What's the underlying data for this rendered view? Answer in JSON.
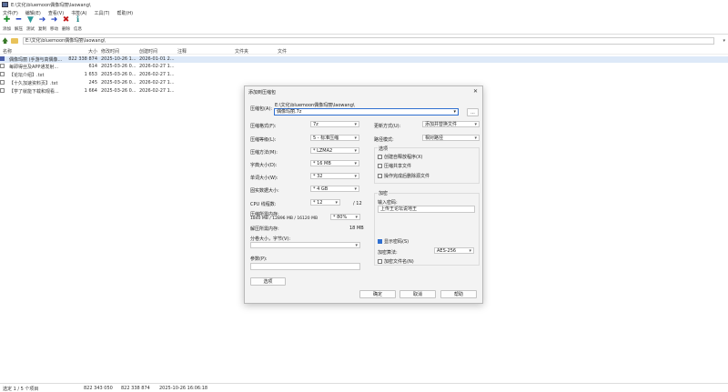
{
  "window": {
    "title": "E:\\文化\\bluemoon偶像玛丽\\laowang\\"
  },
  "menu": [
    "文件(F)",
    "编辑(E)",
    "查看(V)",
    "书签(A)",
    "工具(T)",
    "帮助(H)"
  ],
  "toolbar": [
    {
      "label": "添加",
      "icon": "add-icon",
      "color": "#1a8c2a"
    },
    {
      "label": "解压",
      "icon": "extract-icon",
      "color": "#1e3fbf"
    },
    {
      "label": "测试",
      "icon": "test-icon",
      "color": "#2a9a9a"
    },
    {
      "label": "复制",
      "icon": "copy-icon",
      "color": "#1e3fbf"
    },
    {
      "label": "移动",
      "icon": "move-icon",
      "color": "#1e3fbf"
    },
    {
      "label": "删除",
      "icon": "delete-icon",
      "color": "#c21a1a"
    },
    {
      "label": "信息",
      "icon": "info-icon",
      "color": "#2a8a8a"
    }
  ],
  "address": {
    "path": "E:\\文化\\bluemoon偶像玛丽\\laowang\\"
  },
  "columns": {
    "name": "名称",
    "size": "大小",
    "modified": "修改时间",
    "created": "创建时间",
    "comment": "注释",
    "folders": "文件夹",
    "files": "文件"
  },
  "files": [
    {
      "name": "偶像玛丽 (手游与高偶像...",
      "size": "822 338 874",
      "modified": "2025-10-26 1...",
      "created": "2026-01-01 2..."
    },
    {
      "name": "每即得丝及APP通发射...",
      "size": "614",
      "modified": "2025-03-26 0...",
      "created": "2026-02-27 1..."
    },
    {
      "name": "【论坛介绍】.txt",
      "size": "1 653",
      "modified": "2025-03-26 0...",
      "created": "2026-02-27 1..."
    },
    {
      "name": "【十久加速资料页】.txt",
      "size": "245",
      "modified": "2025-03-26 0...",
      "created": "2026-02-27 1..."
    },
    {
      "name": "【学了就能下载和观看...",
      "size": "1 664",
      "modified": "2025-03-26 0...",
      "created": "2026-02-27 1..."
    }
  ],
  "status": {
    "selection": "选定 1 / 5 个项目",
    "total": "822 343 050",
    "selected_size": "822 338 874",
    "date": "2025-10-26 16:06:18"
  },
  "dialog": {
    "title": "添加到压缩包",
    "close": "✕",
    "archive_label": "压缩包(A):",
    "archive_path": "E:\\文化\\bluemoon偶像玛丽\\laowang\\",
    "archive_name": "偶像玛丽.7z",
    "browse": "...",
    "format_label": "压缩格式(F):",
    "format_value": "7z",
    "level_label": "压缩等级(L):",
    "level_value": "5 - 标准压缩",
    "method_label": "压缩方法(M):",
    "method_value": "* LZMA2",
    "dict_label": "字典大小(D):",
    "dict_value": "* 16 MB",
    "word_label": "单词大小(W):",
    "word_value": "* 32",
    "solid_label": "固实数据大小:",
    "solid_value": "* 4 GB",
    "threads_label": "CPU 线程数:",
    "threads_value": "* 12",
    "threads_total": "/ 12",
    "mem_label": "压缩所需内存:",
    "mem_detail": "1840 MB / 12896 MB / 16120 MB",
    "mem_value": "* 80%",
    "decomp_label": "解压所需内存:",
    "decomp_value": "18 MB",
    "split_label": "分卷大小，字节(V):",
    "params_label": "参数(P):",
    "options_button": "选项",
    "update_label": "更新方式(U):",
    "update_value": "添加并替换文件",
    "path_label": "路径模式:",
    "path_value": "相对路径",
    "options_group": "选项",
    "opt_sfx": "创建自释放程序(X)",
    "opt_shared": "压缩共享文件",
    "opt_delete": "操作完成后删除源文件",
    "encrypt_group": "加密",
    "password_label": "输入密码:",
    "password_value": "上传王论坛说地王",
    "show_password": "显示密码(S)",
    "enc_method_label": "加密算法:",
    "enc_method_value": "AES-256",
    "enc_names": "加密文件名(N)",
    "ok": "确定",
    "cancel": "取消",
    "help": "帮助"
  }
}
